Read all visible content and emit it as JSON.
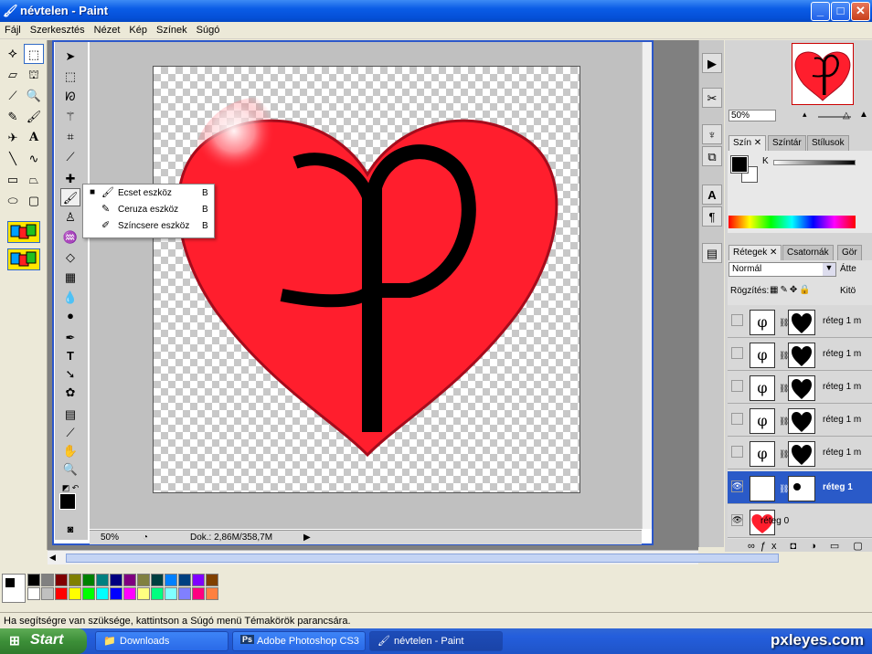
{
  "window": {
    "title": "névtelen - Paint",
    "min": "_",
    "max": "□",
    "close": "✕"
  },
  "menu": [
    "Fájl",
    "Szerkesztés",
    "Nézet",
    "Kép",
    "Színek",
    "Súgó"
  ],
  "canvas": {
    "glyph": "φ",
    "heart_color": "#ff1e2d",
    "glyph_color": "#000000"
  },
  "context_menu": {
    "items": [
      {
        "label": "Ecset eszköz",
        "key": "B",
        "selected": true
      },
      {
        "label": "Ceruza eszköz",
        "key": "B",
        "selected": false
      },
      {
        "label": "Színcsere eszköz",
        "key": "B",
        "selected": false
      }
    ]
  },
  "ps_status": {
    "zoom": "50%",
    "doc": "Dok.: 2,86M/358,7M"
  },
  "navigator": {
    "zoom": "50%"
  },
  "color_panel": {
    "tabs": [
      "Szín",
      "Színtár",
      "Stílusok"
    ],
    "channel": "K"
  },
  "layers_panel": {
    "tabs": [
      "Rétegek",
      "Csatornák",
      "Gör"
    ],
    "blend_mode": "Normál",
    "opacity_label": "Átte",
    "lock_label": "Rögzítés:",
    "fill_label": "Kitö",
    "layers": [
      {
        "name": "réteg 1 m",
        "visible": false,
        "selected": false
      },
      {
        "name": "réteg 1 m",
        "visible": false,
        "selected": false
      },
      {
        "name": "réteg 1 m",
        "visible": false,
        "selected": false
      },
      {
        "name": "réteg 1 m",
        "visible": false,
        "selected": false
      },
      {
        "name": "réteg 1 m",
        "visible": false,
        "selected": false
      },
      {
        "name": "réteg 1",
        "visible": true,
        "selected": true
      },
      {
        "name": "réteg 0",
        "visible": true,
        "selected": false
      }
    ]
  },
  "palette": {
    "row1": [
      "#000000",
      "#808080",
      "#800000",
      "#808000",
      "#008000",
      "#008080",
      "#000080",
      "#800080",
      "#808040",
      "#004040",
      "#0080ff",
      "#004080",
      "#8000ff",
      "#804000"
    ],
    "row2": [
      "#ffffff",
      "#c0c0c0",
      "#ff0000",
      "#ffff00",
      "#00ff00",
      "#00ffff",
      "#0000ff",
      "#ff00ff",
      "#ffff80",
      "#00ff80",
      "#80ffff",
      "#8080ff",
      "#ff0080",
      "#ff8040"
    ]
  },
  "statusbar": {
    "text": "Ha segítségre van szüksége, kattintson a Súgó menü Témakörök parancsára."
  },
  "taskbar": {
    "start": "Start",
    "buttons": [
      {
        "label": "Downloads",
        "icon": "folder-icon"
      },
      {
        "label": "Adobe Photoshop CS3",
        "icon": "photoshop-icon"
      },
      {
        "label": "névtelen - Paint",
        "icon": "paint-icon"
      }
    ],
    "watermark": "pxleyes.com"
  }
}
